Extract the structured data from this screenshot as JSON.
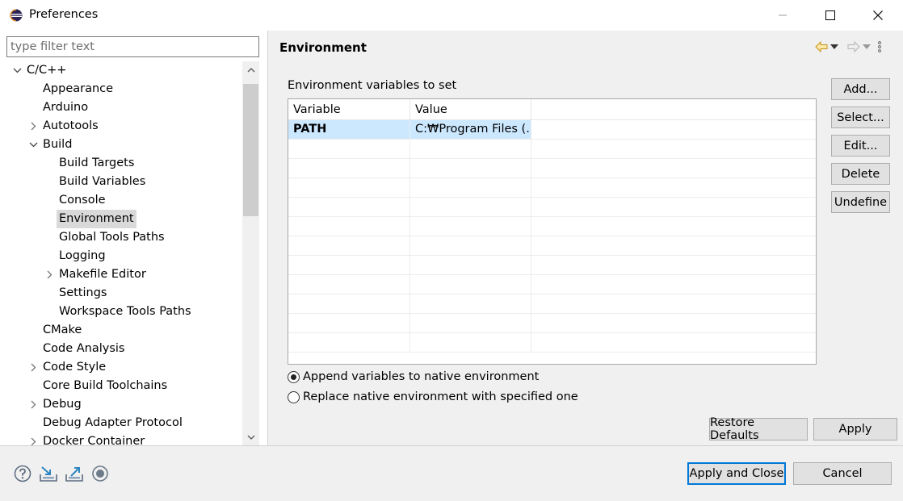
{
  "window": {
    "title": "Preferences"
  },
  "filter": {
    "placeholder": "type filter text"
  },
  "tree": [
    {
      "label": "C/C++",
      "level": 0,
      "expander": "expanded"
    },
    {
      "label": "Appearance",
      "level": 1,
      "expander": "none"
    },
    {
      "label": "Arduino",
      "level": 1,
      "expander": "none"
    },
    {
      "label": "Autotools",
      "level": 1,
      "expander": "collapsed"
    },
    {
      "label": "Build",
      "level": 1,
      "expander": "expanded"
    },
    {
      "label": "Build Targets",
      "level": 2,
      "expander": "none"
    },
    {
      "label": "Build Variables",
      "level": 2,
      "expander": "none"
    },
    {
      "label": "Console",
      "level": 2,
      "expander": "none"
    },
    {
      "label": "Environment",
      "level": 2,
      "expander": "none",
      "selected": true
    },
    {
      "label": "Global Tools Paths",
      "level": 2,
      "expander": "none"
    },
    {
      "label": "Logging",
      "level": 2,
      "expander": "none"
    },
    {
      "label": "Makefile Editor",
      "level": 2,
      "expander": "collapsed"
    },
    {
      "label": "Settings",
      "level": 2,
      "expander": "none"
    },
    {
      "label": "Workspace Tools Paths",
      "level": 2,
      "expander": "none"
    },
    {
      "label": "CMake",
      "level": 1,
      "expander": "none"
    },
    {
      "label": "Code Analysis",
      "level": 1,
      "expander": "none"
    },
    {
      "label": "Code Style",
      "level": 1,
      "expander": "collapsed"
    },
    {
      "label": "Core Build Toolchains",
      "level": 1,
      "expander": "none"
    },
    {
      "label": "Debug",
      "level": 1,
      "expander": "collapsed"
    },
    {
      "label": "Debug Adapter Protocol",
      "level": 1,
      "expander": "none"
    },
    {
      "label": "Docker Container",
      "level": 1,
      "expander": "collapsed"
    }
  ],
  "page": {
    "title": "Environment",
    "section_label": "Environment variables to set",
    "table": {
      "columns": [
        "Variable",
        "Value"
      ],
      "rows": [
        {
          "variable": "PATH",
          "value": "C:₩Program Files (...",
          "selected": true
        }
      ],
      "empty_rows": 11
    },
    "side_buttons": [
      "Add...",
      "Select...",
      "Edit...",
      "Delete",
      "Undefine"
    ],
    "radios": [
      {
        "label": "Append variables to native environment",
        "checked": true
      },
      {
        "label": "Replace native environment with specified one",
        "checked": false
      }
    ],
    "restore_defaults": "Restore Defaults",
    "apply": "Apply"
  },
  "footer": {
    "apply_and_close": "Apply and Close",
    "cancel": "Cancel",
    "icons": [
      "help-icon",
      "import-icon",
      "export-icon",
      "record-icon"
    ]
  },
  "colors": {
    "selection": "#cce8ff",
    "tree_selection": "#d9d9d9",
    "accent": "#0078d7"
  }
}
